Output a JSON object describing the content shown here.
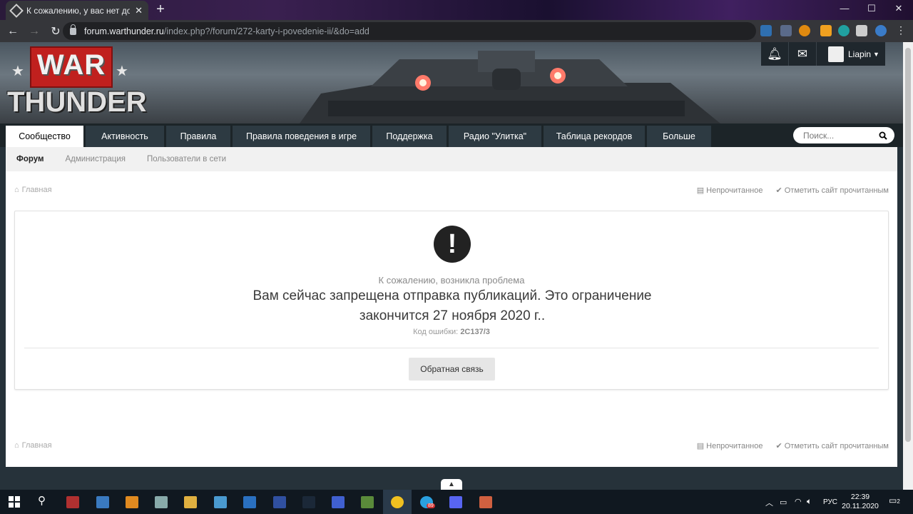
{
  "browser": {
    "tab_title": "К сожалению, у вас нет доступа",
    "url_host": "forum.warthunder.ru",
    "url_path": "/index.php?/forum/272-karty-i-povedenie-ii/&do=add"
  },
  "site": {
    "logo_line1": "WAR",
    "logo_line2": "THUNDER",
    "user_name": "Liapin"
  },
  "nav": {
    "tabs": [
      "Сообщество",
      "Активность",
      "Правила",
      "Правила поведения в игре",
      "Поддержка",
      "Радио \"Улитка\"",
      "Таблица рекордов",
      "Больше"
    ],
    "search_placeholder": "Поиск..."
  },
  "subnav": [
    "Форум",
    "Администрация",
    "Пользователи в сети"
  ],
  "breadcrumb": {
    "home": "Главная",
    "unread": "Непрочитанное",
    "mark_read": "Отметить сайт прочитанным"
  },
  "error": {
    "subtitle": "К сожалению, возникла проблема",
    "message": "Вам сейчас запрещена отправка публикаций. Это ограничение закончится 27 ноября 2020 г..",
    "code_label": "Код ошибки:",
    "code": "2C137/3",
    "feedback_button": "Обратная связь"
  },
  "taskbar": {
    "time": "22:39",
    "date": "20.11.2020",
    "lang": "РУС",
    "notif_count": "2",
    "telegram_badge": "89"
  },
  "colors": {
    "banner_nav": "#1c2428",
    "active_tab": "#ffffff",
    "page_bg": "#26323a"
  }
}
